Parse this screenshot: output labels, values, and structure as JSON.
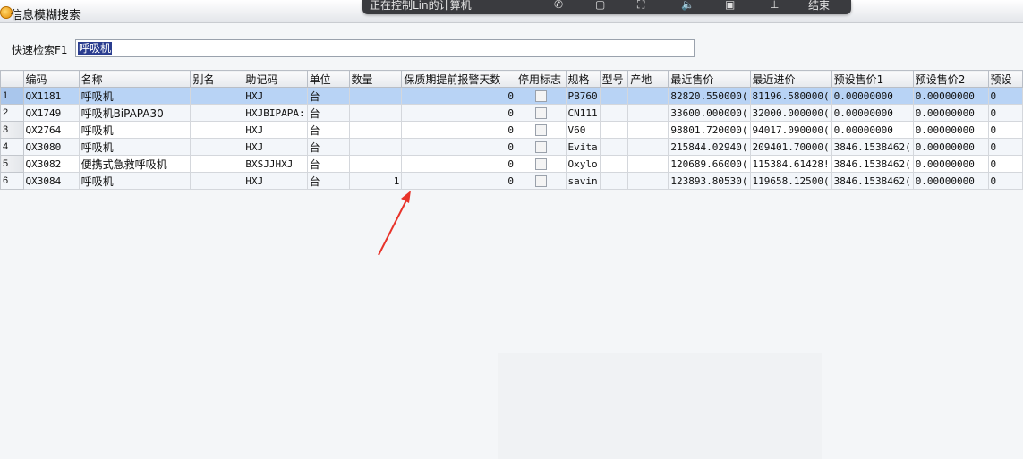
{
  "window": {
    "title": "信息模糊搜索"
  },
  "remote_bar": {
    "status": "正在控制Lin的计算机",
    "end_label": "结束"
  },
  "search": {
    "label": "快速检索F1",
    "value": "呼吸机"
  },
  "table": {
    "columns": [
      "",
      "编码",
      "名称",
      "别名",
      "助记码",
      "单位",
      "数量",
      "保质期提前报警天数",
      "停用标志",
      "规格",
      "型号",
      "产地",
      "最近售价",
      "最近进价",
      "预设售价1",
      "预设售价2",
      "预设"
    ],
    "rows": [
      {
        "n": "1",
        "code": "QX1181",
        "name": "呼吸机",
        "alias": "",
        "mnemonic": "HXJ",
        "unit": "台",
        "qty": "",
        "warn_days": "0",
        "disabled": false,
        "spec": "PB760",
        "model": "",
        "origin": "",
        "last_sale": "82820.550000(",
        "last_buy": "81196.580000(",
        "preset1": "0.00000000",
        "preset2": "0.00000000",
        "preset3": "0"
      },
      {
        "n": "2",
        "code": "QX1749",
        "name": "呼吸机BiPAPA30",
        "alias": "",
        "mnemonic": "HXJBIPAPA:",
        "unit": "台",
        "qty": "",
        "warn_days": "0",
        "disabled": false,
        "spec": "CN111",
        "model": "",
        "origin": "",
        "last_sale": "33600.000000(",
        "last_buy": "32000.000000(",
        "preset1": "0.00000000",
        "preset2": "0.00000000",
        "preset3": "0"
      },
      {
        "n": "3",
        "code": "QX2764",
        "name": "呼吸机",
        "alias": "",
        "mnemonic": "HXJ",
        "unit": "台",
        "qty": "",
        "warn_days": "0",
        "disabled": false,
        "spec": "V60",
        "model": "",
        "origin": "",
        "last_sale": "98801.720000(",
        "last_buy": "94017.090000(",
        "preset1": "0.00000000",
        "preset2": "0.00000000",
        "preset3": "0"
      },
      {
        "n": "4",
        "code": "QX3080",
        "name": "呼吸机",
        "alias": "",
        "mnemonic": "HXJ",
        "unit": "台",
        "qty": "",
        "warn_days": "0",
        "disabled": false,
        "spec": "Evita",
        "model": "",
        "origin": "",
        "last_sale": "215844.02940(",
        "last_buy": "209401.70000(",
        "preset1": "3846.1538462(",
        "preset2": "0.00000000",
        "preset3": "0"
      },
      {
        "n": "5",
        "code": "QX3082",
        "name": "便携式急救呼吸机",
        "alias": "",
        "mnemonic": "BXSJJHXJ",
        "unit": "台",
        "qty": "",
        "warn_days": "0",
        "disabled": false,
        "spec": "Oxylo",
        "model": "",
        "origin": "",
        "last_sale": "120689.66000(",
        "last_buy": "115384.61428!",
        "preset1": "3846.1538462(",
        "preset2": "0.00000000",
        "preset3": "0"
      },
      {
        "n": "6",
        "code": "QX3084",
        "name": "呼吸机",
        "alias": "",
        "mnemonic": "HXJ",
        "unit": "台",
        "qty": "1",
        "warn_days": "0",
        "disabled": false,
        "spec": "savin",
        "model": "",
        "origin": "",
        "last_sale": "123893.80530(",
        "last_buy": "119658.12500(",
        "preset1": "3846.1538462(",
        "preset2": "0.00000000",
        "preset3": "0"
      }
    ]
  },
  "annotation": {
    "color": "#e8332a"
  }
}
